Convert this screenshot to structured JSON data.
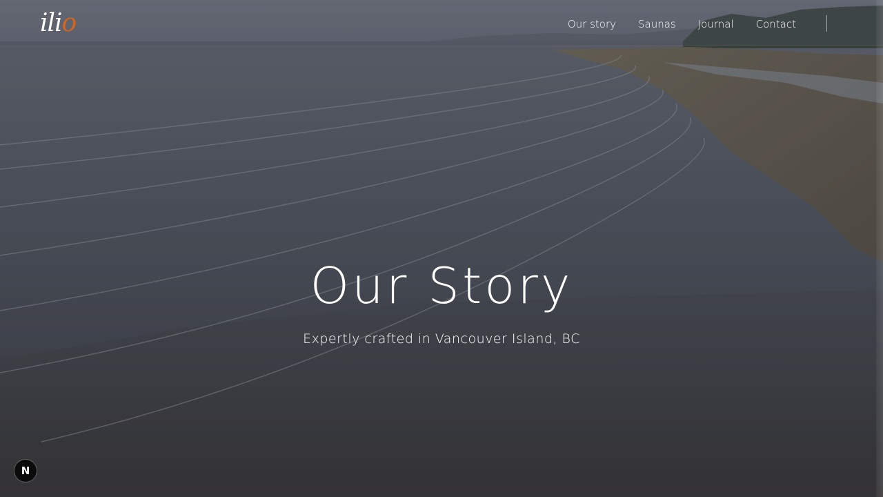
{
  "brand": {
    "logo_main": "ili",
    "logo_accent": "o",
    "accent_color": "#d4651e"
  },
  "nav": {
    "items": [
      {
        "label": "Our story"
      },
      {
        "label": "Saunas"
      },
      {
        "label": "Journal"
      },
      {
        "label": "Contact"
      }
    ]
  },
  "hero": {
    "title": "Our Story",
    "subtitle": "Expertly crafted in Vancouver Island, BC",
    "background": "beach-shoreline-photo"
  },
  "dev_badge": {
    "label": "N",
    "icon": "nextjs-icon"
  }
}
